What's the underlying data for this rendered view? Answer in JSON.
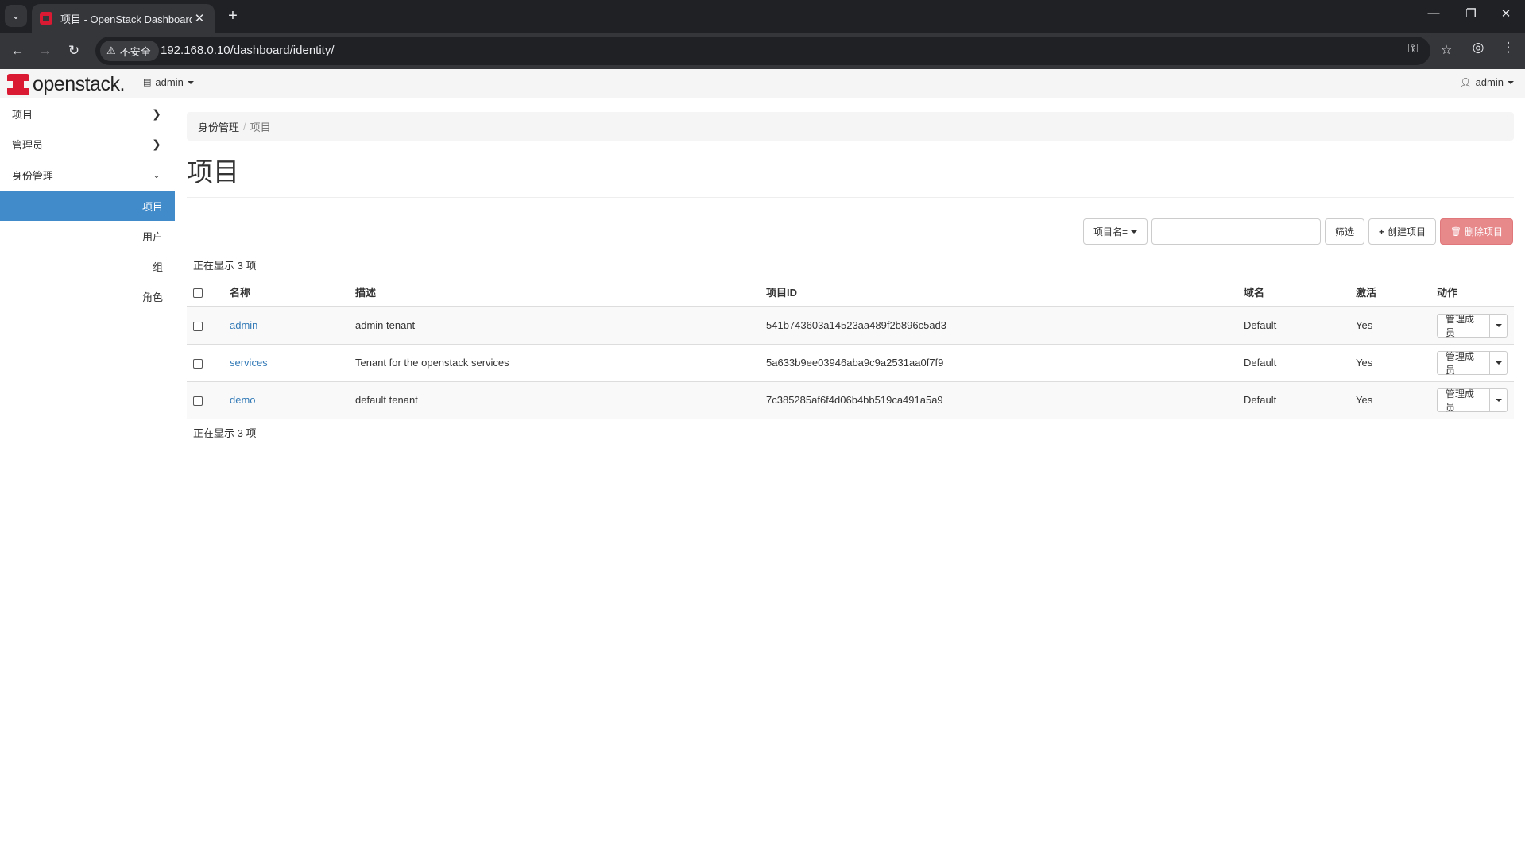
{
  "browser": {
    "tab_title": "项目 - OpenStack Dashboard",
    "security_label": "不安全",
    "url": "192.168.0.10/dashboard/identity/"
  },
  "header": {
    "logo_text": "openstack.",
    "project_switch": "admin",
    "user": "admin"
  },
  "sidebar": {
    "sections": [
      {
        "label": "项目",
        "expanded": false
      },
      {
        "label": "管理员",
        "expanded": false
      },
      {
        "label": "身份管理",
        "expanded": true
      }
    ],
    "items": [
      {
        "label": "项目",
        "active": true
      },
      {
        "label": "用户",
        "active": false
      },
      {
        "label": "组",
        "active": false
      },
      {
        "label": "角色",
        "active": false
      }
    ]
  },
  "breadcrumb": {
    "parent": "身份管理",
    "current": "项目"
  },
  "page": {
    "title": "项目",
    "count_label": "正在显示 3 项"
  },
  "toolbar": {
    "filter_field": "项目名=",
    "filter_value": "",
    "filter_button": "筛选",
    "create_button": "创建项目",
    "delete_button": "删除项目"
  },
  "table": {
    "columns": [
      "名称",
      "描述",
      "项目ID",
      "域名",
      "激活",
      "动作"
    ],
    "rows": [
      {
        "name": "admin",
        "description": "admin tenant",
        "id": "541b743603a14523aa489f2b896c5ad3",
        "domain": "Default",
        "enabled": "Yes",
        "action": "管理成员"
      },
      {
        "name": "services",
        "description": "Tenant for the openstack services",
        "id": "5a633b9ee03946aba9c9a2531aa0f7f9",
        "domain": "Default",
        "enabled": "Yes",
        "action": "管理成员"
      },
      {
        "name": "demo",
        "description": "default tenant",
        "id": "7c385285af6f4d06b4bb519ca491a5a9",
        "domain": "Default",
        "enabled": "Yes",
        "action": "管理成员"
      }
    ]
  }
}
